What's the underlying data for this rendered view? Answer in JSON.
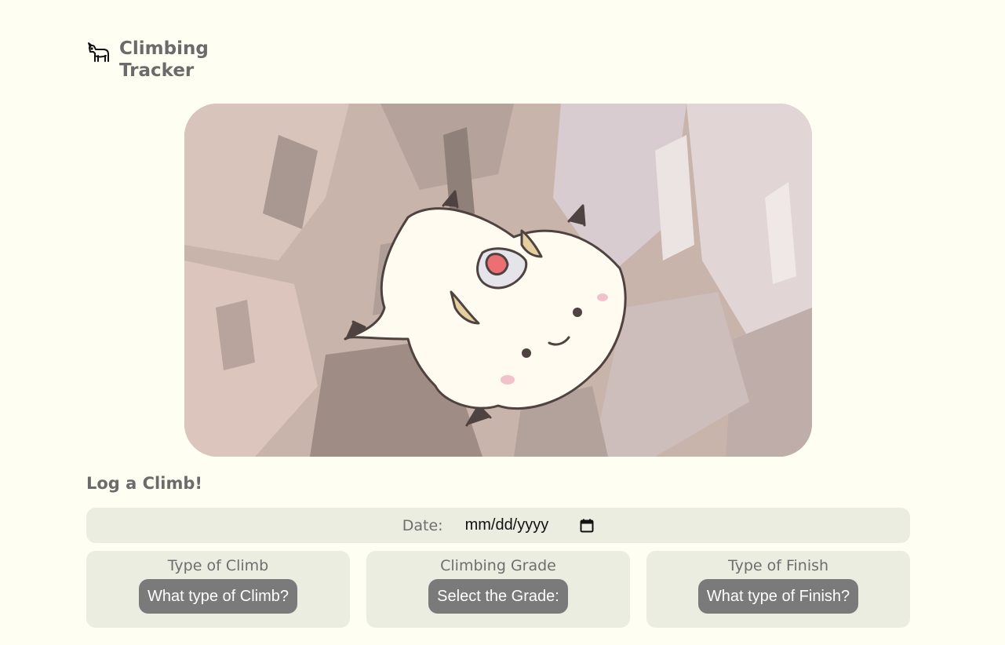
{
  "brand": {
    "title": "Climbing Tracker",
    "icon": "goat-icon"
  },
  "hero": {
    "image": "goat-mascot-on-rock-illustration"
  },
  "log_form": {
    "title": "Log a Climb!",
    "date": {
      "label": "Date:",
      "placeholder": "mm/dd/yyyy",
      "icon": "calendar-icon"
    },
    "type_of_climb": {
      "label": "Type of Climb",
      "button": "What type of Climb?"
    },
    "climbing_grade": {
      "label": "Climbing Grade",
      "button": "Select the Grade:"
    },
    "type_of_finish": {
      "label": "Type of Finish",
      "button": "What type of Finish?"
    }
  },
  "colors": {
    "page_background": "#fefff2",
    "panel_background": "#ecede1",
    "button_background": "#7a7a7a",
    "text_gray": "#6b6b6b"
  }
}
